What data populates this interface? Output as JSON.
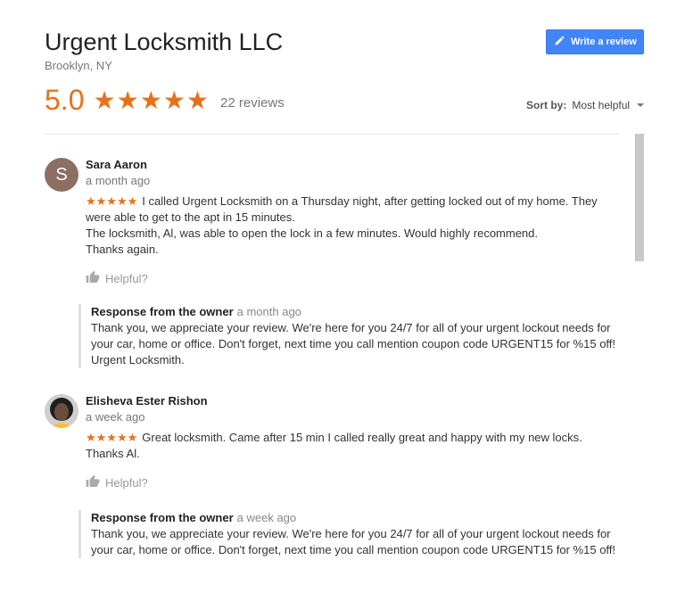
{
  "business": {
    "name": "Urgent Locksmith LLC",
    "location": "Brooklyn, NY",
    "rating": "5.0",
    "stars": "★★★★★",
    "review_count": "22 reviews",
    "write_review_label": "Write a review"
  },
  "sort": {
    "label": "Sort by:",
    "value": "Most helpful"
  },
  "colors": {
    "accent": "#e7711b",
    "button": "#4285f4"
  },
  "reviews": [
    {
      "initial": "S",
      "name": "Sara Aaron",
      "time": "a month ago",
      "stars": "★★★★★",
      "lines": [
        "I called Urgent Locksmith on a Thursday night, after getting locked out of my home.  They",
        "were able to get to the apt in 15 minutes.",
        "The locksmith, Al, was able to open the lock in a few minutes.  Would highly recommend.",
        "Thanks again."
      ],
      "helpful": "Helpful?",
      "response": {
        "title": "Response from the owner",
        "time": "a month ago",
        "lines": [
          "Thank you, we appreciate your review. We're here for you 24/7 for all of your urgent lockout needs for",
          "your car, home or office. Don't forget, next time you call mention coupon code URGENT15 for %15 off!",
          "Urgent Locksmith."
        ]
      }
    },
    {
      "name": "Elisheva Ester Rishon",
      "time": "a week ago",
      "stars": "★★★★★",
      "lines": [
        "Great locksmith. Came after 15 min I called really great and happy with my new locks.",
        "Thanks Al."
      ],
      "helpful": "Helpful?",
      "response": {
        "title": "Response from the owner",
        "time": "a week ago",
        "lines": [
          "Thank you, we appreciate your review. We're here for you 24/7 for all of your urgent lockout needs for",
          "your car, home or office. Don't forget, next time you call mention coupon code URGENT15 for %15 off!"
        ]
      }
    }
  ]
}
